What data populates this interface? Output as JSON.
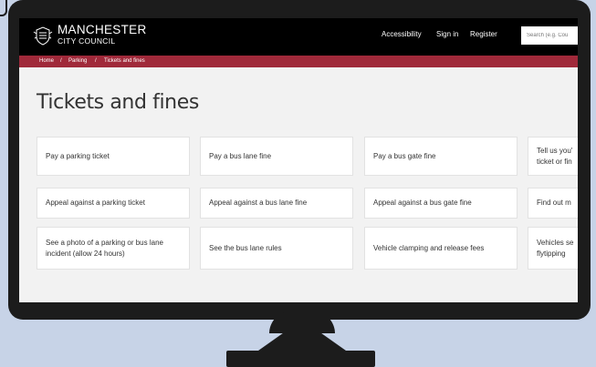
{
  "header": {
    "logo_line1": "MANCHESTER",
    "logo_line2": "CITY COUNCIL",
    "nav": [
      "Accessibility",
      "Sign in",
      "Register"
    ],
    "search_placeholder": "Search (e.g. Cou"
  },
  "breadcrumb": {
    "items": [
      "Home",
      "Parking",
      "Tickets and fines"
    ],
    "separator": "/"
  },
  "page": {
    "title": "Tickets and fines"
  },
  "cards": [
    [
      "Pay a parking ticket",
      "Pay a bus lane fine",
      "Pay a bus gate fine",
      "Tell us you'\nticket or fin"
    ],
    [
      "Appeal against a parking ticket",
      "Appeal against a bus lane fine",
      "Appeal against a bus gate fine",
      "Find out m"
    ],
    [
      "See a photo of a parking or bus lane incident (allow 24 hours)",
      "See the bus lane rules",
      "Vehicle clamping and release fees",
      "Vehicles se\nflytipping"
    ]
  ],
  "colors": {
    "header_bg": "#000000",
    "breadcrumb_bg": "#a0293a",
    "page_bg": "#f2f2f2",
    "monitor": "#1c1c1c",
    "backdrop": "#c7d3e7"
  }
}
